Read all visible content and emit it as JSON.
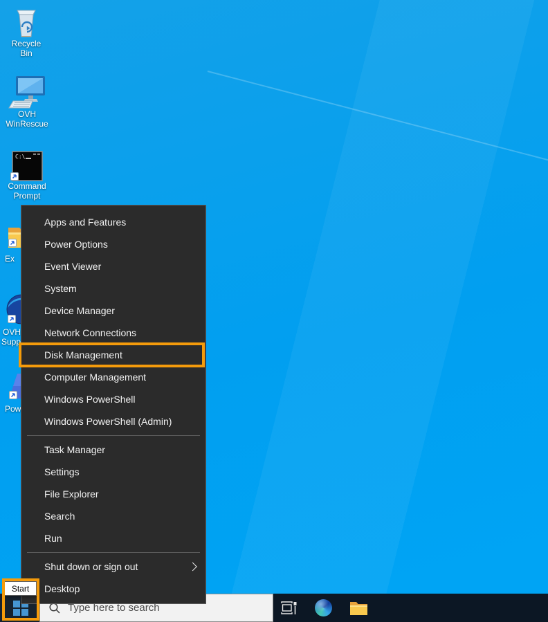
{
  "desktop": {
    "icons": {
      "recycle_bin": {
        "label": "Recycle Bin"
      },
      "ovh_winrescue": {
        "line1": "OVH",
        "line2": "WinRescue"
      },
      "command_prompt": {
        "line1": "Command",
        "line2": "Prompt",
        "screen_text": "C:\\"
      },
      "partial_folder": {
        "label": "Ex"
      },
      "partial_ovh_support": {
        "line1": "OVH",
        "line2": "Supp"
      },
      "partial_pow": {
        "label": "Pow"
      }
    }
  },
  "menu": {
    "items": [
      "Apps and Features",
      "Power Options",
      "Event Viewer",
      "System",
      "Device Manager",
      "Network Connections",
      "Disk Management",
      "Computer Management",
      "Windows PowerShell",
      "Windows PowerShell (Admin)",
      "Task Manager",
      "Settings",
      "File Explorer",
      "Search",
      "Run",
      "Shut down or sign out",
      "Desktop"
    ],
    "highlighted_item": "Disk Management"
  },
  "taskbar": {
    "start_tooltip": "Start",
    "search_placeholder": "Type here to search",
    "icons": [
      "task-view",
      "microsoft-edge",
      "file-explorer"
    ]
  },
  "colors": {
    "desktop_blue": "#00A1EC",
    "menu_bg": "#2B2B2B",
    "menu_text": "#F2F2F2",
    "taskbar_bg": "#0C1724",
    "highlight_orange": "#F49B0B",
    "search_bg": "#F2F2F2",
    "search_text": "#4A4A4A",
    "start_logo_blue": "#4796D2",
    "tooltip_bg": "#FFFFFF"
  }
}
